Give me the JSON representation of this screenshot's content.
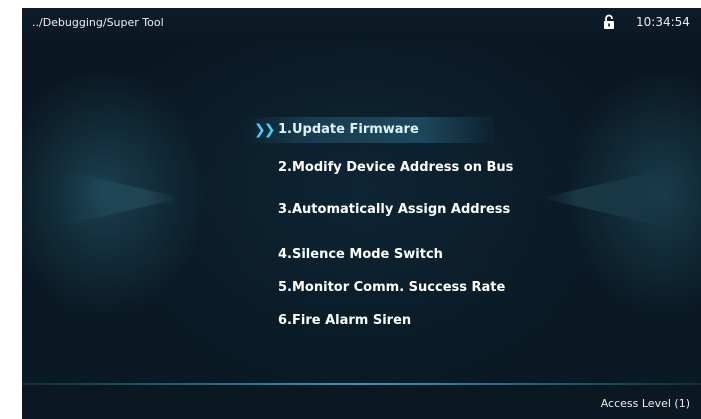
{
  "header": {
    "breadcrumb": "../Debugging/Super Tool",
    "time": "10:34:54",
    "lock_icon": "lock-icon"
  },
  "menu": {
    "items": [
      {
        "label": "1.Update Firmware",
        "selected": true
      },
      {
        "label": "2.Modify Device Address on Bus",
        "selected": false
      },
      {
        "label": "3.Automatically Assign Address",
        "selected": false
      },
      {
        "label": "4.Silence Mode Switch",
        "selected": false
      },
      {
        "label": "5.Monitor Comm. Success Rate",
        "selected": false
      },
      {
        "label": "6.Fire Alarm Siren",
        "selected": false
      }
    ],
    "selection_indicator": "chevron-double-right-icon",
    "accent_color": "#3fd0ff"
  },
  "footer": {
    "access_level": "Access Level  (1)"
  }
}
